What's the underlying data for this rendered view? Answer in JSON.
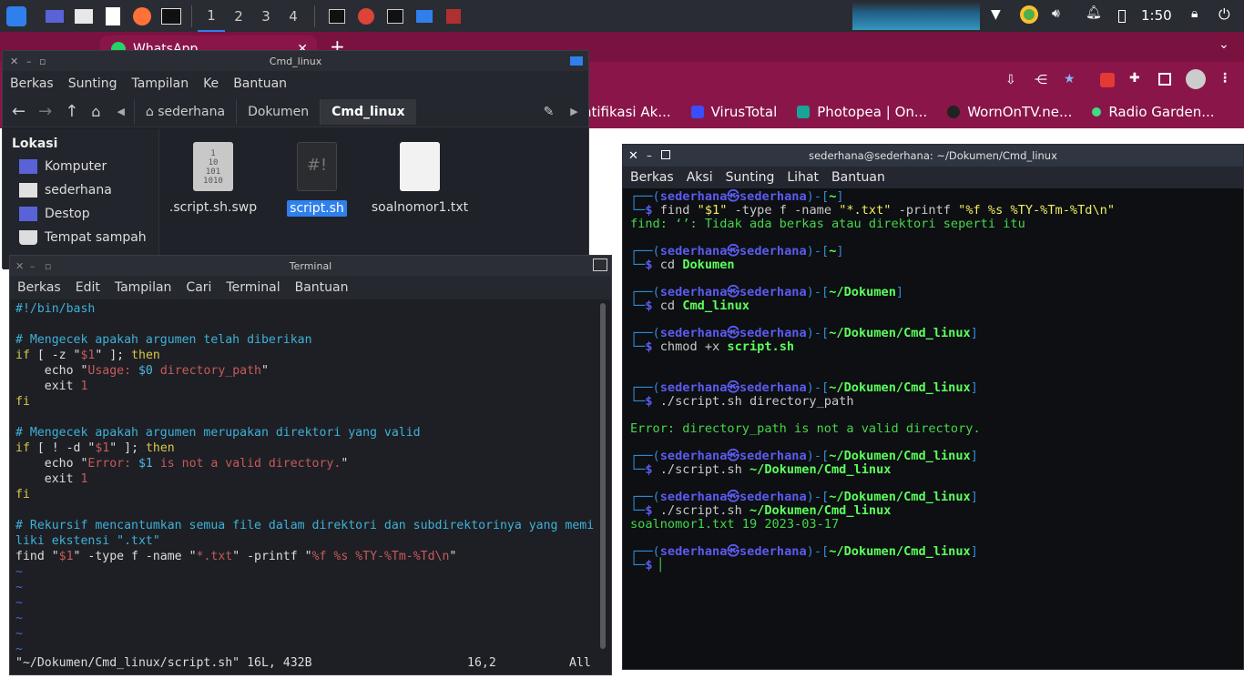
{
  "taskbar": {
    "workspaces": [
      "1",
      "2",
      "3",
      "4"
    ],
    "clock": "1:50"
  },
  "browser": {
    "tab_title": "WhatsApp",
    "bookmarks": [
      "ntifikasi Ak...",
      "VirusTotal",
      "Photopea | On...",
      "WornOnTV.ne...",
      "Radio Garden..."
    ],
    "colors": {
      "bar": "#8a1549"
    }
  },
  "file_manager": {
    "title": "Cmd_linux",
    "menu": [
      "Berkas",
      "Sunting",
      "Tampilan",
      "Ke",
      "Bantuan"
    ],
    "breadcrumbs": [
      "sederhana",
      "Dokumen",
      "Cmd_linux"
    ],
    "side_header": "Lokasi",
    "side_items": [
      "Komputer",
      "sederhana",
      "Destop",
      "Tempat sampah"
    ],
    "files": [
      ".script.sh.swp",
      "script.sh",
      "soalnomor1.txt"
    ],
    "swp_icon_text": "1\n10\n101\n1010",
    "script_icon_text": "#!"
  },
  "vim": {
    "title": "Terminal",
    "menu": [
      "Berkas",
      "Edit",
      "Tampilan",
      "Cari",
      "Terminal",
      "Bantuan"
    ],
    "lines": [
      [
        {
          "t": "#!/bin/bash",
          "c": "c-cm"
        }
      ],
      [],
      [
        {
          "t": "# Mengecek apakah argumen telah diberikan",
          "c": "c-cm"
        }
      ],
      [
        {
          "t": "if",
          "c": "c-kw"
        },
        {
          "t": " [ -z \"",
          "c": "c-plain"
        },
        {
          "t": "$1",
          "c": "c-str"
        },
        {
          "t": "\" ]; ",
          "c": "c-plain"
        },
        {
          "t": "then",
          "c": "c-kw"
        }
      ],
      [
        {
          "t": "    echo \"",
          "c": "c-plain"
        },
        {
          "t": "Usage: ",
          "c": "c-str"
        },
        {
          "t": "$0",
          "c": "c-var"
        },
        {
          "t": " directory_path",
          "c": "c-str"
        },
        {
          "t": "\"",
          "c": "c-plain"
        }
      ],
      [
        {
          "t": "    exit ",
          "c": "c-plain"
        },
        {
          "t": "1",
          "c": "c-str"
        }
      ],
      [
        {
          "t": "fi",
          "c": "c-kw"
        }
      ],
      [],
      [
        {
          "t": "# Mengecek apakah argumen merupakan direktori yang valid",
          "c": "c-cm"
        }
      ],
      [
        {
          "t": "if",
          "c": "c-kw"
        },
        {
          "t": " [ ! -d \"",
          "c": "c-plain"
        },
        {
          "t": "$1",
          "c": "c-str"
        },
        {
          "t": "\" ]; ",
          "c": "c-plain"
        },
        {
          "t": "then",
          "c": "c-kw"
        }
      ],
      [
        {
          "t": "    echo \"",
          "c": "c-plain"
        },
        {
          "t": "Error: ",
          "c": "c-str"
        },
        {
          "t": "$1",
          "c": "c-var"
        },
        {
          "t": " is not a valid directory.",
          "c": "c-str"
        },
        {
          "t": "\"",
          "c": "c-plain"
        }
      ],
      [
        {
          "t": "    exit ",
          "c": "c-plain"
        },
        {
          "t": "1",
          "c": "c-str"
        }
      ],
      [
        {
          "t": "fi",
          "c": "c-kw"
        }
      ],
      [],
      [
        {
          "t": "# Rekursif mencantumkan semua file dalam direktori dan subdirektorinya yang memi",
          "c": "c-cm"
        }
      ],
      [
        {
          "t": "liki ekstensi \".txt\"",
          "c": "c-cm"
        }
      ],
      [
        {
          "t": "find \"",
          "c": "c-plain"
        },
        {
          "t": "$1",
          "c": "c-str"
        },
        {
          "t": "\" -type f -name \"",
          "c": "c-plain"
        },
        {
          "t": "*.txt",
          "c": "c-str"
        },
        {
          "t": "\" -printf \"",
          "c": "c-plain"
        },
        {
          "t": "%f %s %TY-%Tm-%Td\\n",
          "c": "c-str"
        },
        {
          "t": "\"",
          "c": "c-plain"
        }
      ],
      [
        {
          "t": "~",
          "c": "c-tilde"
        }
      ],
      [
        {
          "t": "~",
          "c": "c-tilde"
        }
      ],
      [
        {
          "t": "~",
          "c": "c-tilde"
        }
      ],
      [
        {
          "t": "~",
          "c": "c-tilde"
        }
      ],
      [
        {
          "t": "~",
          "c": "c-tilde"
        }
      ],
      [
        {
          "t": "~",
          "c": "c-tilde"
        }
      ]
    ],
    "status_file": "\"~/Dokumen/Cmd_linux/script.sh\" 16L, 432B",
    "status_pos": "16,2",
    "status_all": "All"
  },
  "kali": {
    "title": "sederhana@sederhana: ~/Dokumen/Cmd_linux",
    "menu": [
      "Berkas",
      "Aksi",
      "Sunting",
      "Lihat",
      "Bantuan"
    ],
    "lines": [
      [
        {
          "t": "┌──(",
          "c": "k-b"
        },
        {
          "t": "sederhana㉿sederhana",
          "c": "k-u"
        },
        {
          "t": ")-[",
          "c": "k-b"
        },
        {
          "t": "~",
          "c": "k-path"
        },
        {
          "t": "]",
          "c": "k-b"
        }
      ],
      [
        {
          "t": "└─",
          "c": "k-b"
        },
        {
          "t": "$ ",
          "c": "k-u"
        },
        {
          "t": "find ",
          "c": "k-w"
        },
        {
          "t": "\"$1\"",
          "c": "k-y"
        },
        {
          "t": " -type f -name ",
          "c": "k-w"
        },
        {
          "t": "\"*.txt\"",
          "c": "k-y"
        },
        {
          "t": " -printf ",
          "c": "k-w"
        },
        {
          "t": "\"%f %s %TY-%Tm-%Td\\n\"",
          "c": "k-y"
        }
      ],
      [
        {
          "t": "find: ‘’: Tidak ada berkas atau direktori seperti itu",
          "c": "k-o"
        }
      ],
      [],
      [
        {
          "t": "┌──(",
          "c": "k-b"
        },
        {
          "t": "sederhana㉿sederhana",
          "c": "k-u"
        },
        {
          "t": ")-[",
          "c": "k-b"
        },
        {
          "t": "~",
          "c": "k-path"
        },
        {
          "t": "]",
          "c": "k-b"
        }
      ],
      [
        {
          "t": "└─",
          "c": "k-b"
        },
        {
          "t": "$ ",
          "c": "k-u"
        },
        {
          "t": "cd ",
          "c": "k-w"
        },
        {
          "t": "Dokumen",
          "c": "k-path"
        }
      ],
      [],
      [
        {
          "t": "┌──(",
          "c": "k-b"
        },
        {
          "t": "sederhana㉿sederhana",
          "c": "k-u"
        },
        {
          "t": ")-[",
          "c": "k-b"
        },
        {
          "t": "~/Dokumen",
          "c": "k-path"
        },
        {
          "t": "]",
          "c": "k-b"
        }
      ],
      [
        {
          "t": "└─",
          "c": "k-b"
        },
        {
          "t": "$ ",
          "c": "k-u"
        },
        {
          "t": "cd ",
          "c": "k-w"
        },
        {
          "t": "Cmd_linux",
          "c": "k-path"
        }
      ],
      [],
      [
        {
          "t": "┌──(",
          "c": "k-b"
        },
        {
          "t": "sederhana㉿sederhana",
          "c": "k-u"
        },
        {
          "t": ")-[",
          "c": "k-b"
        },
        {
          "t": "~/Dokumen/Cmd_linux",
          "c": "k-path"
        },
        {
          "t": "]",
          "c": "k-b"
        }
      ],
      [
        {
          "t": "└─",
          "c": "k-b"
        },
        {
          "t": "$ ",
          "c": "k-u"
        },
        {
          "t": "chmod +x ",
          "c": "k-w"
        },
        {
          "t": "script.sh",
          "c": "k-path"
        }
      ],
      [],
      [],
      [
        {
          "t": "┌──(",
          "c": "k-b"
        },
        {
          "t": "sederhana㉿sederhana",
          "c": "k-u"
        },
        {
          "t": ")-[",
          "c": "k-b"
        },
        {
          "t": "~/Dokumen/Cmd_linux",
          "c": "k-path"
        },
        {
          "t": "]",
          "c": "k-b"
        }
      ],
      [
        {
          "t": "└─",
          "c": "k-b"
        },
        {
          "t": "$ ",
          "c": "k-u"
        },
        {
          "t": "./script.sh directory_path",
          "c": "k-w"
        }
      ],
      [],
      [
        {
          "t": "Error: directory_path is not a valid directory.",
          "c": "k-o"
        }
      ],
      [],
      [
        {
          "t": "┌──(",
          "c": "k-b"
        },
        {
          "t": "sederhana㉿sederhana",
          "c": "k-u"
        },
        {
          "t": ")-[",
          "c": "k-b"
        },
        {
          "t": "~/Dokumen/Cmd_linux",
          "c": "k-path"
        },
        {
          "t": "]",
          "c": "k-b"
        }
      ],
      [
        {
          "t": "└─",
          "c": "k-b"
        },
        {
          "t": "$ ",
          "c": "k-u"
        },
        {
          "t": "./script.sh ",
          "c": "k-w"
        },
        {
          "t": "~/Dokumen/Cmd_linux",
          "c": "k-path"
        }
      ],
      [],
      [
        {
          "t": "┌──(",
          "c": "k-b"
        },
        {
          "t": "sederhana㉿sederhana",
          "c": "k-u"
        },
        {
          "t": ")-[",
          "c": "k-b"
        },
        {
          "t": "~/Dokumen/Cmd_linux",
          "c": "k-path"
        },
        {
          "t": "]",
          "c": "k-b"
        }
      ],
      [
        {
          "t": "└─",
          "c": "k-b"
        },
        {
          "t": "$ ",
          "c": "k-u"
        },
        {
          "t": "./script.sh ",
          "c": "k-w"
        },
        {
          "t": "~/Dokumen/Cmd_linux",
          "c": "k-path"
        }
      ],
      [
        {
          "t": "soalnomor1.txt 19 2023-03-17",
          "c": "k-o"
        }
      ],
      [],
      [
        {
          "t": "┌──(",
          "c": "k-b"
        },
        {
          "t": "sederhana㉿sederhana",
          "c": "k-u"
        },
        {
          "t": ")-[",
          "c": "k-b"
        },
        {
          "t": "~/Dokumen/Cmd_linux",
          "c": "k-path"
        },
        {
          "t": "]",
          "c": "k-b"
        }
      ],
      [
        {
          "t": "└─",
          "c": "k-b"
        },
        {
          "t": "$ ",
          "c": "k-u"
        },
        {
          "t": "▏",
          "c": "k-g"
        }
      ]
    ]
  }
}
